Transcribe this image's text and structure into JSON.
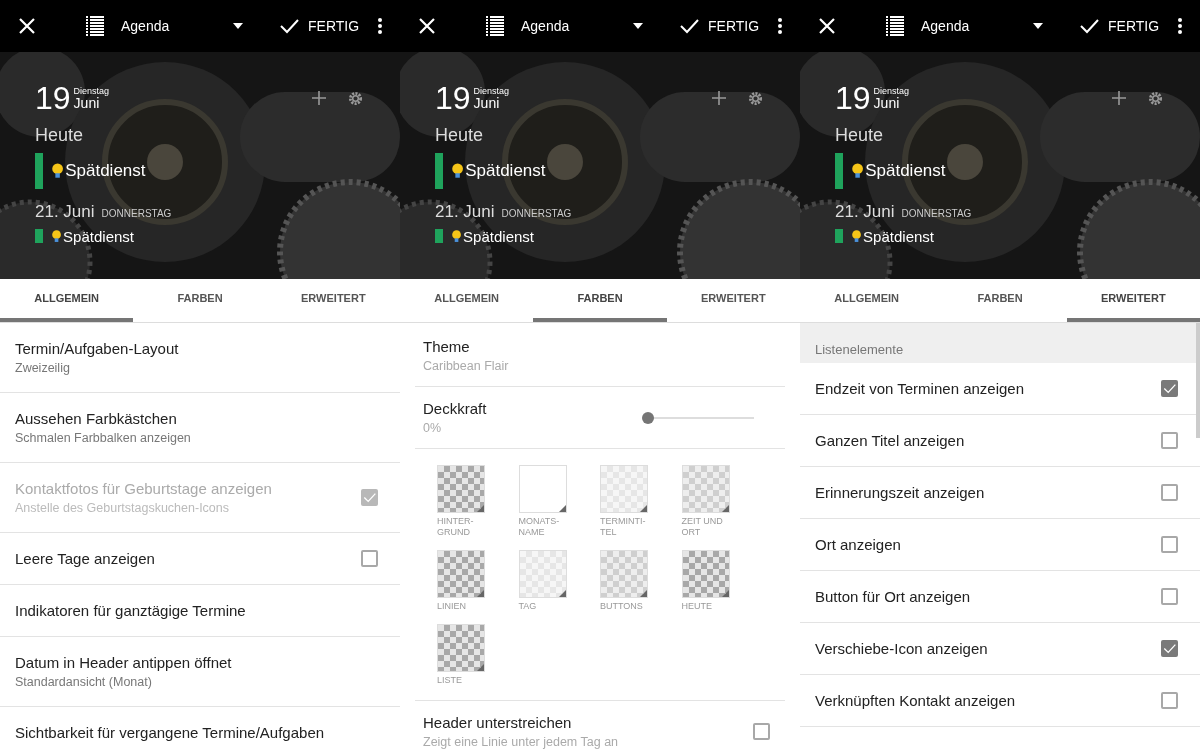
{
  "phones": [
    {
      "toolbar": {
        "view": "Agenda",
        "done": "FERTIG"
      },
      "widget": {
        "day": "19",
        "weekday": "Dienstag",
        "month": "Juni",
        "today": "Heute",
        "events": [
          {
            "title": "Spätdienst",
            "color": "#1fa35c"
          }
        ],
        "next_date": "21. Juni",
        "next_weekday": "DONNERSTAG",
        "next_events": [
          {
            "title": "Spätdienst",
            "color": "#1fa35c"
          }
        ]
      },
      "tabs": [
        {
          "label": "ALLGEMEIN",
          "selected": true
        },
        {
          "label": "FARBEN",
          "selected": false
        },
        {
          "label": "ERWEITERT",
          "selected": false
        }
      ],
      "items": [
        {
          "kind": "text",
          "title": "Termin/Aufgaben-Layout",
          "subtitle": "Zweizeilig"
        },
        {
          "kind": "text",
          "title": "Aussehen Farbkästchen",
          "subtitle": "Schmalen Farbbalken anzeigen"
        },
        {
          "kind": "checkbox",
          "title": "Kontaktfotos für Geburtstage anzeigen",
          "subtitle": "Anstelle des Geburtstagskuchen-Icons",
          "checked": true,
          "disabled": true
        },
        {
          "kind": "checkbox",
          "title": "Leere Tage anzeigen",
          "checked": false,
          "disabled": false
        },
        {
          "kind": "text",
          "title": "Indikatoren für ganztägige Termine"
        },
        {
          "kind": "text",
          "title": "Datum in Header antippen öffnet",
          "subtitle": "Standardansicht (Monat)"
        },
        {
          "kind": "text",
          "title": "Sichtbarkeit für vergangene Termine/Aufgaben"
        }
      ]
    },
    {
      "toolbar": {
        "view": "Agenda",
        "done": "FERTIG"
      },
      "widget": {
        "day": "19",
        "weekday": "Dienstag",
        "month": "Juni",
        "today": "Heute",
        "events": [
          {
            "title": "Spätdienst",
            "color": "#1fa35c"
          }
        ],
        "next_date": "21. Juni",
        "next_weekday": "DONNERSTAG",
        "next_events": [
          {
            "title": "Spätdienst",
            "color": "#1fa35c"
          }
        ]
      },
      "tabs": [
        {
          "label": "ALLGEMEIN",
          "selected": false
        },
        {
          "label": "FARBEN",
          "selected": true
        },
        {
          "label": "ERWEITERT",
          "selected": false
        }
      ],
      "items": [
        {
          "kind": "text",
          "title": "Theme",
          "subtitle": "Caribbean Flair"
        },
        {
          "kind": "slider",
          "title": "Deckkraft",
          "subtitle": "0%",
          "level": 0
        },
        {
          "kind": "swatches",
          "swatches": [
            {
              "label": "HINTER-\nGRUND",
              "kind": "strong"
            },
            {
              "label": "MONATS-\nNAME",
              "kind": "white"
            },
            {
              "label": "TERMINTI-\nTEL",
              "kind": "faint"
            },
            {
              "label": "ZEIT UND\nORT",
              "kind": "light"
            },
            {
              "label": "LINIEN",
              "kind": "strong"
            },
            {
              "label": "TAG",
              "kind": "faint"
            },
            {
              "label": "BUTTONS",
              "kind": "light"
            },
            {
              "label": "HEUTE",
              "kind": "strong"
            },
            {
              "label": "LISTE",
              "kind": "strong"
            }
          ]
        },
        {
          "kind": "checkbox",
          "title": "Header unterstreichen",
          "subtitle": "Zeigt eine Linie unter jedem Tag an",
          "checked": false,
          "disabled": false
        }
      ]
    },
    {
      "toolbar": {
        "view": "Agenda",
        "done": "FERTIG"
      },
      "widget": {
        "day": "19",
        "weekday": "Dienstag",
        "month": "Juni",
        "today": "Heute",
        "events": [
          {
            "title": "Spätdienst",
            "color": "#1fa35c"
          }
        ],
        "next_date": "21. Juni",
        "next_weekday": "DONNERSTAG",
        "next_events": [
          {
            "title": "Spätdienst",
            "color": "#1fa35c"
          }
        ]
      },
      "tabs": [
        {
          "label": "ALLGEMEIN",
          "selected": false
        },
        {
          "label": "FARBEN",
          "selected": false
        },
        {
          "label": "ERWEITERT",
          "selected": true
        }
      ],
      "items": [
        {
          "kind": "header",
          "title": "Listenelemente"
        },
        {
          "kind": "checkbox",
          "title": "Endzeit von Terminen anzeigen",
          "checked": true,
          "disabled": false
        },
        {
          "kind": "checkbox",
          "title": "Ganzen Titel anzeigen",
          "checked": false,
          "disabled": false
        },
        {
          "kind": "checkbox",
          "title": "Erinnerungszeit anzeigen",
          "checked": false,
          "disabled": false
        },
        {
          "kind": "checkbox",
          "title": "Ort anzeigen",
          "checked": false,
          "disabled": false
        },
        {
          "kind": "checkbox",
          "title": "Button für Ort anzeigen",
          "checked": false,
          "disabled": false
        },
        {
          "kind": "checkbox",
          "title": "Verschiebe-Icon anzeigen",
          "checked": true,
          "disabled": false
        },
        {
          "kind": "checkbox",
          "title": "Verknüpften Kontakt anzeigen",
          "checked": false,
          "disabled": false
        }
      ]
    }
  ]
}
